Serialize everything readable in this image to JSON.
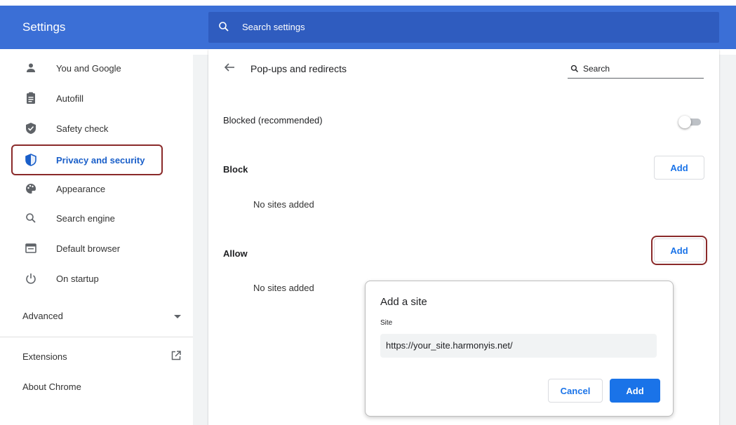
{
  "header": {
    "title": "Settings",
    "search_placeholder": "Search settings"
  },
  "sidebar": {
    "items": [
      {
        "label": "You and Google",
        "icon": "person-icon"
      },
      {
        "label": "Autofill",
        "icon": "clipboard-icon"
      },
      {
        "label": "Safety check",
        "icon": "shield-check-icon"
      },
      {
        "label": "Privacy and security",
        "icon": "shield-icon",
        "active": true
      },
      {
        "label": "Appearance",
        "icon": "palette-icon"
      },
      {
        "label": "Search engine",
        "icon": "search-icon"
      },
      {
        "label": "Default browser",
        "icon": "browser-icon"
      },
      {
        "label": "On startup",
        "icon": "power-icon"
      }
    ],
    "advanced_label": "Advanced",
    "extensions_label": "Extensions",
    "about_label": "About Chrome"
  },
  "page": {
    "title": "Pop-ups and redirects",
    "search_placeholder": "Search",
    "blocked_label": "Blocked (recommended)",
    "blocked_toggle_on": false,
    "block_section": "Block",
    "block_empty": "No sites added",
    "allow_section": "Allow",
    "allow_empty": "No sites added",
    "add_label": "Add"
  },
  "dialog": {
    "title": "Add a site",
    "field_label": "Site",
    "field_value": "https://your_site.harmonyis.net/",
    "cancel_label": "Cancel",
    "add_label": "Add"
  },
  "colors": {
    "header": "#3b6fd6",
    "accent": "#1a73e8",
    "highlight": "#8a2a2a"
  }
}
